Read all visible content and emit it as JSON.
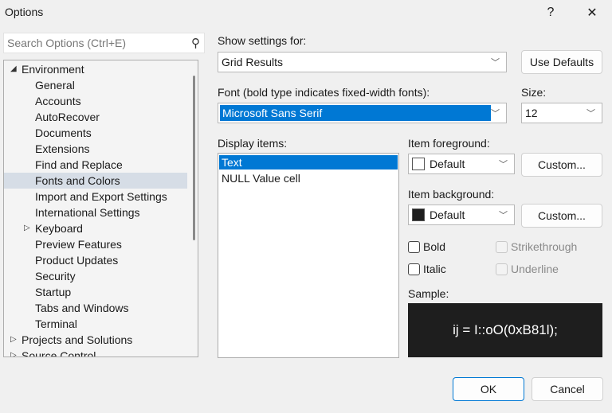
{
  "window": {
    "title": "Options",
    "help_label": "?",
    "close_label": "✕"
  },
  "search": {
    "placeholder": "Search Options (Ctrl+E)"
  },
  "tree": [
    {
      "label": "Environment",
      "level": 0,
      "expander": "expanded"
    },
    {
      "label": "General",
      "level": 1
    },
    {
      "label": "Accounts",
      "level": 1
    },
    {
      "label": "AutoRecover",
      "level": 1
    },
    {
      "label": "Documents",
      "level": 1
    },
    {
      "label": "Extensions",
      "level": 1
    },
    {
      "label": "Find and Replace",
      "level": 1
    },
    {
      "label": "Fonts and Colors",
      "level": 1,
      "selected": true
    },
    {
      "label": "Import and Export Settings",
      "level": 1
    },
    {
      "label": "International Settings",
      "level": 1
    },
    {
      "label": "Keyboard",
      "level": 1,
      "expander": "collapsed"
    },
    {
      "label": "Preview Features",
      "level": 1
    },
    {
      "label": "Product Updates",
      "level": 1
    },
    {
      "label": "Security",
      "level": 1
    },
    {
      "label": "Startup",
      "level": 1
    },
    {
      "label": "Tabs and Windows",
      "level": 1
    },
    {
      "label": "Terminal",
      "level": 1
    },
    {
      "label": "Projects and Solutions",
      "level": 0,
      "expander": "collapsed"
    },
    {
      "label": "Source Control",
      "level": 0,
      "expander": "collapsed"
    }
  ],
  "settings": {
    "show_for_label": "Show settings for:",
    "show_for_value": "Grid Results",
    "use_defaults": "Use Defaults",
    "font_label": "Font (bold type indicates fixed-width fonts):",
    "font_value": "Microsoft Sans Serif",
    "size_label": "Size:",
    "size_value": "12",
    "display_items_label": "Display items:",
    "display_items": [
      "Text",
      "NULL Value cell"
    ],
    "fg_label": "Item foreground:",
    "fg_value": "Default",
    "fg_color": "#ffffff",
    "custom": "Custom...",
    "bg_label": "Item background:",
    "bg_value": "Default",
    "bg_color": "#1e1e1e",
    "bold": "Bold",
    "italic": "Italic",
    "strike": "Strikethrough",
    "underline": "Underline",
    "sample_label": "Sample:",
    "sample_text": "ij = I::oO(0xB81l);"
  },
  "footer": {
    "ok": "OK",
    "cancel": "Cancel"
  }
}
